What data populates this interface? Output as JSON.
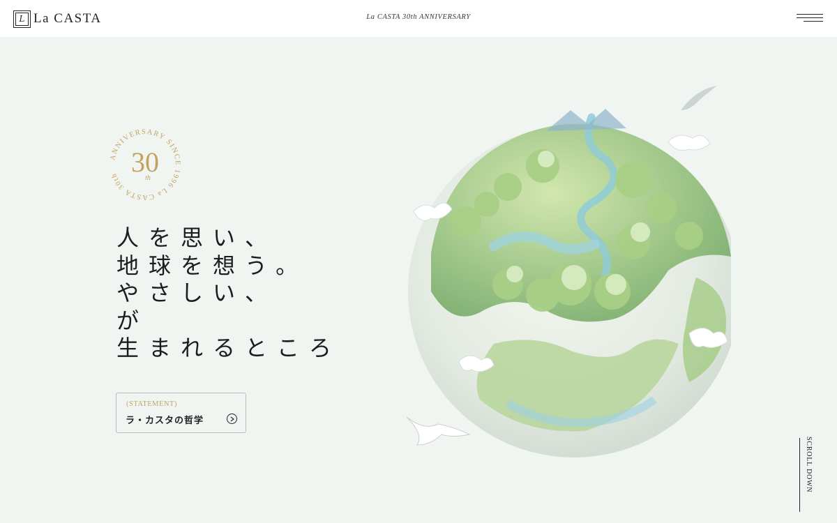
{
  "header": {
    "logo_text": "La CASTA",
    "title": "La CASTA 30th ANNIVERSARY",
    "menu_icon": "hamburger-menu-icon"
  },
  "badge": {
    "ring_text": "ANNIVERSARY SINCE 1996 La CASTA 30th",
    "number": "30",
    "suffix": "th",
    "accent_color": "#c3a25f"
  },
  "headline": {
    "lines": [
      "人を思い、",
      "地球を想う。",
      "やさしい、",
      "が",
      "生まれるところ"
    ]
  },
  "statement": {
    "kicker": "(STATEMENT)",
    "label": "ラ・カスタの哲学",
    "arrow_icon": "arrow-circle-right-icon"
  },
  "scroll": {
    "label": "SCROLL DOWN"
  },
  "colors": {
    "background": "#f1f5f2",
    "header_bg": "#ffffff",
    "gold": "#c3a25f"
  }
}
